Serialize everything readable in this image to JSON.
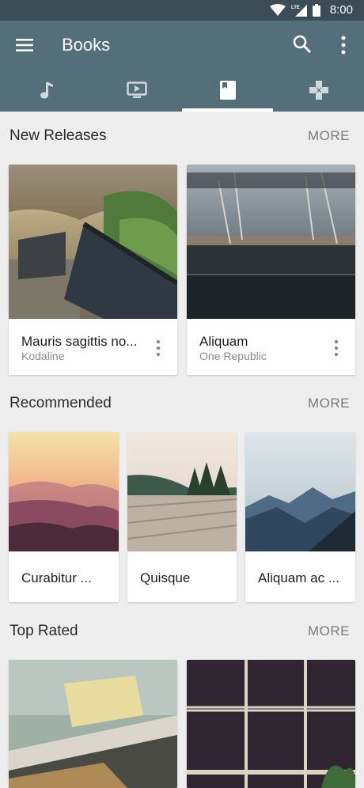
{
  "status_bar": {
    "time": "8:00",
    "network": "LTE"
  },
  "app_bar": {
    "title": "Books"
  },
  "tabs": [
    {
      "name": "music",
      "icon": "music-note-icon"
    },
    {
      "name": "video",
      "icon": "tv-play-icon"
    },
    {
      "name": "books",
      "icon": "book-icon",
      "active": true
    },
    {
      "name": "games",
      "icon": "gamepad-icon"
    }
  ],
  "sections": {
    "new_releases": {
      "title": "New Releases",
      "more": "MORE",
      "items": [
        {
          "title": "Mauris sagittis no...",
          "subtitle": "Kodaline"
        },
        {
          "title": "Aliquam",
          "subtitle": "One Republic"
        }
      ]
    },
    "recommended": {
      "title": "Recommended",
      "more": "MORE",
      "items": [
        {
          "title": "Curabitur ..."
        },
        {
          "title": "Quisque"
        },
        {
          "title": "Aliquam ac ..."
        }
      ]
    },
    "top_rated": {
      "title": "Top Rated",
      "more": "MORE"
    }
  },
  "colors": {
    "status_bar": "#3c4c56",
    "app_bar": "#546e7a",
    "background": "#eeeeee",
    "card": "#ffffff"
  }
}
